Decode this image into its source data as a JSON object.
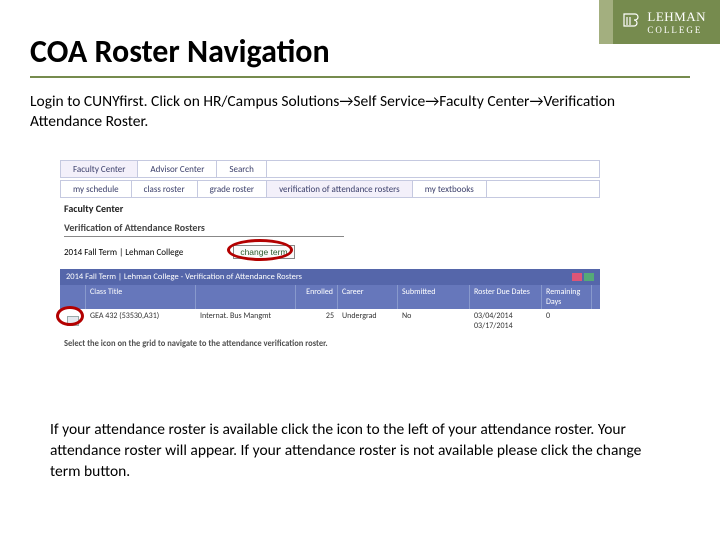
{
  "brand": {
    "name": "LEHMAN",
    "sub": "COLLEGE"
  },
  "title": "COA Roster Navigation",
  "intro": "Login to CUNYfirst. Click on HR/Campus Solutions→Self Service→Faculty Center→Verification Attendance Roster.",
  "tabs_top": {
    "a": "Faculty Center",
    "b": "Advisor Center",
    "c": "Search"
  },
  "tabs_sub": {
    "a": "my schedule",
    "b": "class roster",
    "c": "grade roster",
    "d": "verification of attendance rosters",
    "e": "my textbooks"
  },
  "faculty_center": "Faculty Center",
  "subhead": "Verification of Attendance Rosters",
  "term": "2014 Fall Term | Lehman College",
  "change_term": "change term",
  "barhead": "2014 Fall Term | Lehman College - Verification of Attendance Rosters",
  "cols": {
    "c1": "Class Title",
    "c2": "",
    "c3": "Enrolled",
    "c4": "Career",
    "c5": "Submitted",
    "c6": "Roster Due Dates",
    "c7": "Remaining Days"
  },
  "row": {
    "r1": "GEA 432 (53530,A31)",
    "r2": "Internat. Bus Mangmt",
    "r3": "25",
    "r4": "Undergrad",
    "r5": "No",
    "r6": "03/04/2014",
    "r6b": "03/17/2014",
    "r7": "0"
  },
  "hint": "Select the icon on the grid to navigate to the attendance verification roster.",
  "footer": "If your attendance roster is available click the icon to the left of your attendance roster.  Your attendance roster will appear. If your attendance roster is not available please click the change term button."
}
